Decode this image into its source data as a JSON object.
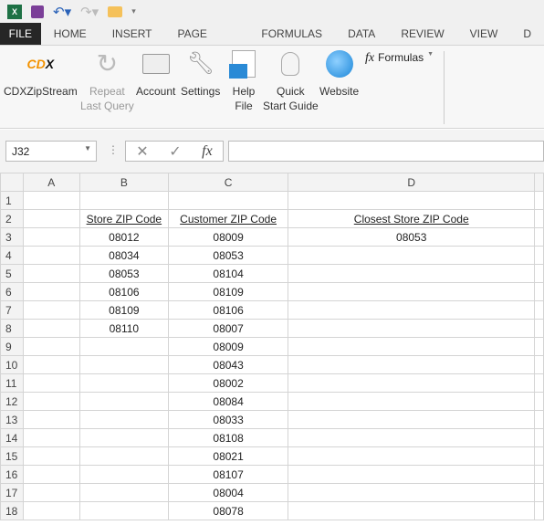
{
  "quick_access": {
    "icons": [
      "excel-icon",
      "save-icon",
      "undo-icon",
      "redo-icon",
      "open-folder-icon",
      "customize-icon"
    ]
  },
  "tabs": [
    "FILE",
    "HOME",
    "INSERT",
    "PAGE LAYOUT",
    "FORMULAS",
    "DATA",
    "REVIEW",
    "VIEW",
    "D"
  ],
  "ribbon": {
    "buttons": [
      {
        "line1": "CDXZipStream",
        "line2": ""
      },
      {
        "line1": "Repeat",
        "line2": "Last Query"
      },
      {
        "line1": "Account",
        "line2": ""
      },
      {
        "line1": "Settings",
        "line2": ""
      },
      {
        "line1": "Help",
        "line2": "File"
      },
      {
        "line1": "Quick",
        "line2": "Start Guide"
      },
      {
        "line1": "Website",
        "line2": ""
      }
    ],
    "formulas_label": "Formulas",
    "fx_symbol": "fx",
    "logo_text": "CDX"
  },
  "formula_bar": {
    "name_box": "J32",
    "formula": "",
    "fx": "fx",
    "cancel": "✕",
    "enter": "✓"
  },
  "columns": [
    "A",
    "B",
    "C",
    "D"
  ],
  "rows": [
    [
      "1",
      "",
      "",
      "",
      ""
    ],
    [
      "2",
      "",
      "Store ZIP Code",
      "Customer ZIP Code",
      "Closest Store ZIP Code"
    ],
    [
      "3",
      "",
      "08012",
      "08009",
      "08053"
    ],
    [
      "4",
      "",
      "08034",
      "08053",
      ""
    ],
    [
      "5",
      "",
      "08053",
      "08104",
      ""
    ],
    [
      "6",
      "",
      "08106",
      "08109",
      ""
    ],
    [
      "7",
      "",
      "08109",
      "08106",
      ""
    ],
    [
      "8",
      "",
      "08110",
      "08007",
      ""
    ],
    [
      "9",
      "",
      "",
      "08009",
      ""
    ],
    [
      "10",
      "",
      "",
      "08043",
      ""
    ],
    [
      "11",
      "",
      "",
      "08002",
      ""
    ],
    [
      "12",
      "",
      "",
      "08084",
      ""
    ],
    [
      "13",
      "",
      "",
      "08033",
      ""
    ],
    [
      "14",
      "",
      "",
      "08108",
      ""
    ],
    [
      "15",
      "",
      "",
      "08021",
      ""
    ],
    [
      "16",
      "",
      "",
      "08107",
      ""
    ],
    [
      "17",
      "",
      "",
      "08004",
      ""
    ],
    [
      "18",
      "",
      "",
      "08078",
      ""
    ]
  ]
}
